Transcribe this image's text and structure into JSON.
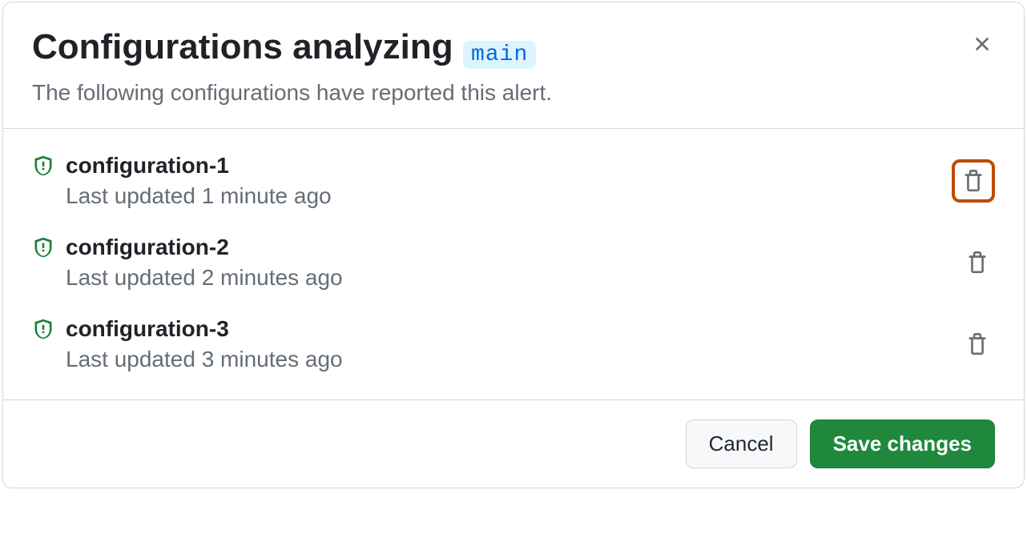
{
  "header": {
    "title": "Configurations analyzing",
    "branch": "main",
    "subtitle": "The following configurations have reported this alert."
  },
  "configurations": [
    {
      "name": "configuration-1",
      "meta": "Last updated 1 minute ago",
      "highlighted": true
    },
    {
      "name": "configuration-2",
      "meta": "Last updated 2 minutes ago",
      "highlighted": false
    },
    {
      "name": "configuration-3",
      "meta": "Last updated 3 minutes ago",
      "highlighted": false
    }
  ],
  "footer": {
    "cancel_label": "Cancel",
    "save_label": "Save changes"
  }
}
